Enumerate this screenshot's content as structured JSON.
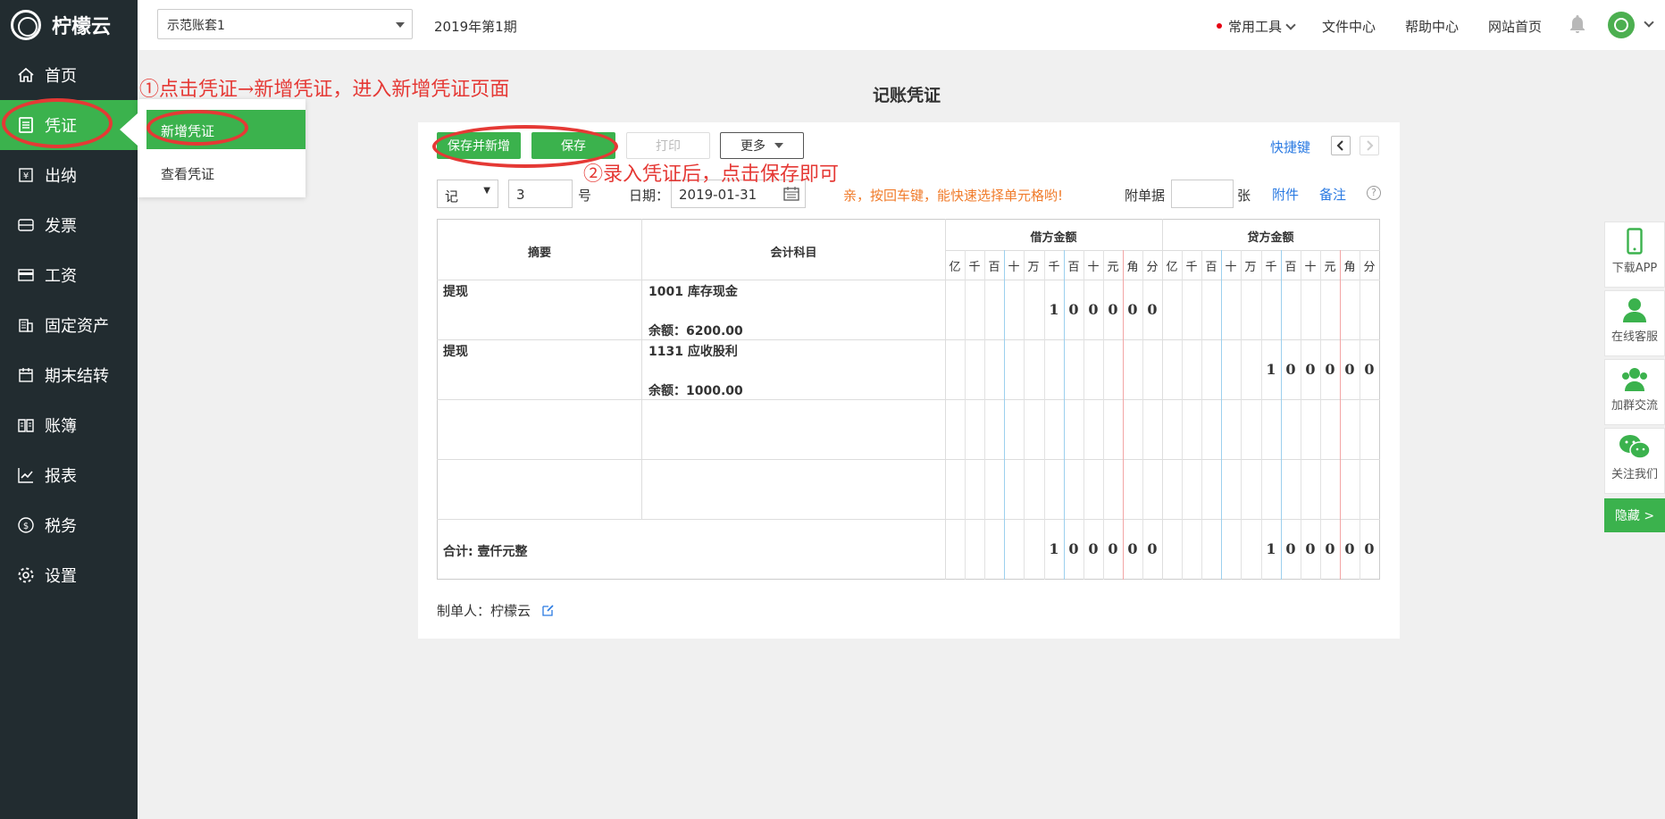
{
  "app": {
    "brand": "柠檬云"
  },
  "header": {
    "account_set": "示范账套1",
    "period": "2019年第1期",
    "nav": [
      "常用工具",
      "文件中心",
      "帮助中心",
      "网站首页"
    ]
  },
  "sidebar": {
    "items": [
      {
        "label": "首页",
        "icon": "home-icon"
      },
      {
        "label": "凭证",
        "icon": "voucher-icon"
      },
      {
        "label": "出纳",
        "icon": "cashier-icon"
      },
      {
        "label": "发票",
        "icon": "invoice-icon"
      },
      {
        "label": "工资",
        "icon": "salary-icon"
      },
      {
        "label": "固定资产",
        "icon": "asset-icon"
      },
      {
        "label": "期末结转",
        "icon": "calendar-icon"
      },
      {
        "label": "账簿",
        "icon": "ledger-icon"
      },
      {
        "label": "报表",
        "icon": "chart-icon"
      },
      {
        "label": "税务",
        "icon": "tax-icon"
      },
      {
        "label": "设置",
        "icon": "gear-icon"
      }
    ],
    "submenu": [
      "新增凭证",
      "查看凭证"
    ]
  },
  "annotations": {
    "step1": "①点击凭证→新增凭证，进入新增凭证页面",
    "step2": "②录入凭证后，点击保存即可"
  },
  "voucher": {
    "title": "记账凭证",
    "buttons": {
      "save_new": "保存并新增",
      "save": "保存",
      "print": "打印",
      "more": "更多"
    },
    "shortcut": "快捷键",
    "type": "记",
    "number": "3",
    "number_suffix": "号",
    "date_label": "日期：",
    "date": "2019-01-31",
    "hint": "亲，按回车键，能快速选择单元格哟!",
    "attach_label": "附单据",
    "attach_unit": "张",
    "attachment": "附件",
    "remark": "备注",
    "help": "?",
    "columns": {
      "summary": "摘要",
      "account": "会计科目",
      "debit": "借方金额",
      "credit": "贷方金额"
    },
    "units": [
      "亿",
      "千",
      "百",
      "十",
      "万",
      "千",
      "百",
      "十",
      "元",
      "角",
      "分"
    ],
    "rows": [
      {
        "summary": "提现",
        "account": "1001 库存现金",
        "balance": "余额：6200.00",
        "debit": [
          "1",
          "0",
          "0",
          "0",
          "0",
          "0"
        ],
        "credit": []
      },
      {
        "summary": "提现",
        "account": "1131 应收股利",
        "balance": "余额：1000.00",
        "debit": [],
        "credit": [
          "1",
          "0",
          "0",
          "0",
          "0",
          "0"
        ]
      }
    ],
    "total_label": "合计: 壹仟元整",
    "total_debit": [
      "1",
      "0",
      "0",
      "0",
      "0",
      "0"
    ],
    "total_credit": [
      "1",
      "0",
      "0",
      "0",
      "0",
      "0"
    ],
    "maker_label": "制单人：",
    "maker": "柠檬云"
  },
  "float_bar": [
    "下载APP",
    "在线客服",
    "加群交流",
    "关注我们"
  ],
  "hide_label": "隐藏 >"
}
